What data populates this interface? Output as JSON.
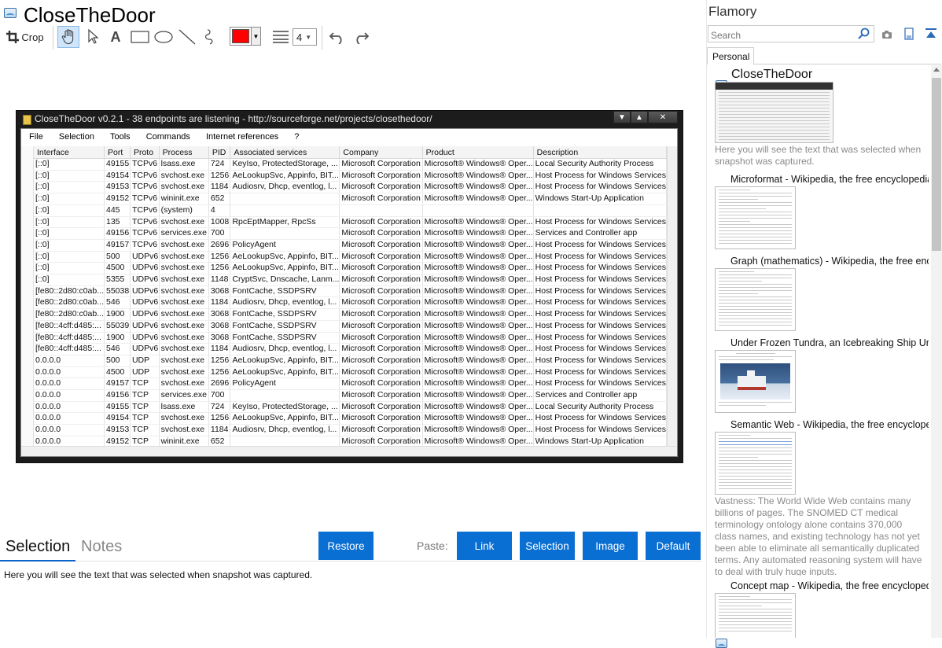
{
  "app": {
    "title": "CloseTheDoor"
  },
  "toolbar": {
    "crop_label": "Crop",
    "line_width": "4",
    "color": "#ff0000"
  },
  "snapshot": {
    "window_title": "CloseTheDoor v0.2.1 - 38 endpoints are listening - http://sourceforge.net/projects/closethedoor/",
    "menu": [
      "File",
      "Selection",
      "Tools",
      "Commands",
      "Internet references",
      "?"
    ],
    "columns": [
      "Interface",
      "Port",
      "Proto",
      "Process",
      "PID",
      "Associated services",
      "Company",
      "Product",
      "Description"
    ],
    "rows": [
      [
        "[::0]",
        "49155",
        "TCPv6",
        "lsass.exe",
        "724",
        "KeyIso, ProtectedStorage, ...",
        "Microsoft Corporation",
        "Microsoft® Windows® Oper...",
        "Local Security Authority Process"
      ],
      [
        "[::0]",
        "49154",
        "TCPv6",
        "svchost.exe",
        "1256",
        "AeLookupSvc, Appinfo, BIT...",
        "Microsoft Corporation",
        "Microsoft® Windows® Oper...",
        "Host Process for Windows Services"
      ],
      [
        "[::0]",
        "49153",
        "TCPv6",
        "svchost.exe",
        "1184",
        "Audiosrv, Dhcp, eventlog, l...",
        "Microsoft Corporation",
        "Microsoft® Windows® Oper...",
        "Host Process for Windows Services"
      ],
      [
        "[::0]",
        "49152",
        "TCPv6",
        "wininit.exe",
        "652",
        "",
        "Microsoft Corporation",
        "Microsoft® Windows® Oper...",
        "Windows Start-Up Application"
      ],
      [
        "[::0]",
        "445",
        "TCPv6",
        "(system)",
        "4",
        "",
        "",
        "",
        ""
      ],
      [
        "[::0]",
        "135",
        "TCPv6",
        "svchost.exe",
        "1008",
        "RpcEptMapper, RpcSs",
        "Microsoft Corporation",
        "Microsoft® Windows® Oper...",
        "Host Process for Windows Services"
      ],
      [
        "[::0]",
        "49156",
        "TCPv6",
        "services.exe",
        "700",
        "",
        "Microsoft Corporation",
        "Microsoft® Windows® Oper...",
        "Services and Controller app"
      ],
      [
        "[::0]",
        "49157",
        "TCPv6",
        "svchost.exe",
        "2696",
        "PolicyAgent",
        "Microsoft Corporation",
        "Microsoft® Windows® Oper...",
        "Host Process for Windows Services"
      ],
      [
        "[::0]",
        "500",
        "UDPv6",
        "svchost.exe",
        "1256",
        "AeLookupSvc, Appinfo, BIT...",
        "Microsoft Corporation",
        "Microsoft® Windows® Oper...",
        "Host Process for Windows Services"
      ],
      [
        "[::0]",
        "4500",
        "UDPv6",
        "svchost.exe",
        "1256",
        "AeLookupSvc, Appinfo, BIT...",
        "Microsoft Corporation",
        "Microsoft® Windows® Oper...",
        "Host Process for Windows Services"
      ],
      [
        "[::0]",
        "5355",
        "UDPv6",
        "svchost.exe",
        "1148",
        "CryptSvc, Dnscache, Lanm...",
        "Microsoft Corporation",
        "Microsoft® Windows® Oper...",
        "Host Process for Windows Services"
      ],
      [
        "[fe80::2d80:c0ab...",
        "55038",
        "UDPv6",
        "svchost.exe",
        "3068",
        "FontCache, SSDPSRV",
        "Microsoft Corporation",
        "Microsoft® Windows® Oper...",
        "Host Process for Windows Services"
      ],
      [
        "[fe80::2d80:c0ab...",
        "546",
        "UDPv6",
        "svchost.exe",
        "1184",
        "Audiosrv, Dhcp, eventlog, l...",
        "Microsoft Corporation",
        "Microsoft® Windows® Oper...",
        "Host Process for Windows Services"
      ],
      [
        "[fe80::2d80:c0ab...",
        "1900",
        "UDPv6",
        "svchost.exe",
        "3068",
        "FontCache, SSDPSRV",
        "Microsoft Corporation",
        "Microsoft® Windows® Oper...",
        "Host Process for Windows Services"
      ],
      [
        "[fe80::4cff:d485:...",
        "55039",
        "UDPv6",
        "svchost.exe",
        "3068",
        "FontCache, SSDPSRV",
        "Microsoft Corporation",
        "Microsoft® Windows® Oper...",
        "Host Process for Windows Services"
      ],
      [
        "[fe80::4cff:d485:...",
        "1900",
        "UDPv6",
        "svchost.exe",
        "3068",
        "FontCache, SSDPSRV",
        "Microsoft Corporation",
        "Microsoft® Windows® Oper...",
        "Host Process for Windows Services"
      ],
      [
        "[fe80::4cff:d485:...",
        "546",
        "UDPv6",
        "svchost.exe",
        "1184",
        "Audiosrv, Dhcp, eventlog, l...",
        "Microsoft Corporation",
        "Microsoft® Windows® Oper...",
        "Host Process for Windows Services"
      ],
      [
        "0.0.0.0",
        "500",
        "UDP",
        "svchost.exe",
        "1256",
        "AeLookupSvc, Appinfo, BIT...",
        "Microsoft Corporation",
        "Microsoft® Windows® Oper...",
        "Host Process for Windows Services"
      ],
      [
        "0.0.0.0",
        "4500",
        "UDP",
        "svchost.exe",
        "1256",
        "AeLookupSvc, Appinfo, BIT...",
        "Microsoft Corporation",
        "Microsoft® Windows® Oper...",
        "Host Process for Windows Services"
      ],
      [
        "0.0.0.0",
        "49157",
        "TCP",
        "svchost.exe",
        "2696",
        "PolicyAgent",
        "Microsoft Corporation",
        "Microsoft® Windows® Oper...",
        "Host Process for Windows Services"
      ],
      [
        "0.0.0.0",
        "49156",
        "TCP",
        "services.exe",
        "700",
        "",
        "Microsoft Corporation",
        "Microsoft® Windows® Oper...",
        "Services and Controller app"
      ],
      [
        "0.0.0.0",
        "49155",
        "TCP",
        "lsass.exe",
        "724",
        "KeyIso, ProtectedStorage, ...",
        "Microsoft Corporation",
        "Microsoft® Windows® Oper...",
        "Local Security Authority Process"
      ],
      [
        "0.0.0.0",
        "49154",
        "TCP",
        "svchost.exe",
        "1256",
        "AeLookupSvc, Appinfo, BIT...",
        "Microsoft Corporation",
        "Microsoft® Windows® Oper...",
        "Host Process for Windows Services"
      ],
      [
        "0.0.0.0",
        "49153",
        "TCP",
        "svchost.exe",
        "1184",
        "Audiosrv, Dhcp, eventlog, l...",
        "Microsoft Corporation",
        "Microsoft® Windows® Oper...",
        "Host Process for Windows Services"
      ],
      [
        "0.0.0.0",
        "49152",
        "TCP",
        "wininit.exe",
        "652",
        "",
        "Microsoft Corporation",
        "Microsoft® Windows® Oper...",
        "Windows Start-Up Application"
      ]
    ]
  },
  "bottom": {
    "tab_selection": "Selection",
    "tab_notes": "Notes",
    "restore_label": "Restore",
    "paste_label": "Paste:",
    "link_label": "Link",
    "selection_label": "Selection",
    "image_label": "Image",
    "default_label": "Default",
    "notes_text": "Here you will see the text that was selected when snapshot was captured.",
    "accent": "#0a6fd2"
  },
  "panel": {
    "title": "Flamory",
    "search_placeholder": "Search",
    "tab_personal": "Personal",
    "items": [
      {
        "title": "CloseTheDoor",
        "desc": "Here you will see the text that was selected when snapshot was captured."
      },
      {
        "title": "Microformat - Wikipedia, the free encyclopedia",
        "desc": ""
      },
      {
        "title": "Graph (mathematics) - Wikipedia, the free ency",
        "desc": ""
      },
      {
        "title": "Under Frozen Tundra, an Icebreaking Ship Unco",
        "desc": ""
      },
      {
        "title": "Semantic Web - Wikipedia, the free encycloped",
        "desc": "Vastness: The World Wide Web contains many billions of pages. The SNOMED CT medical terminology ontology alone contains 370,000 class names, and existing technology has not yet been able to eliminate all semantically duplicated terms. Any automated reasoning system will have to deal with truly huge inputs."
      },
      {
        "title": "Concept map - Wikipedia, the free encyclopedi",
        "desc": ""
      }
    ]
  }
}
